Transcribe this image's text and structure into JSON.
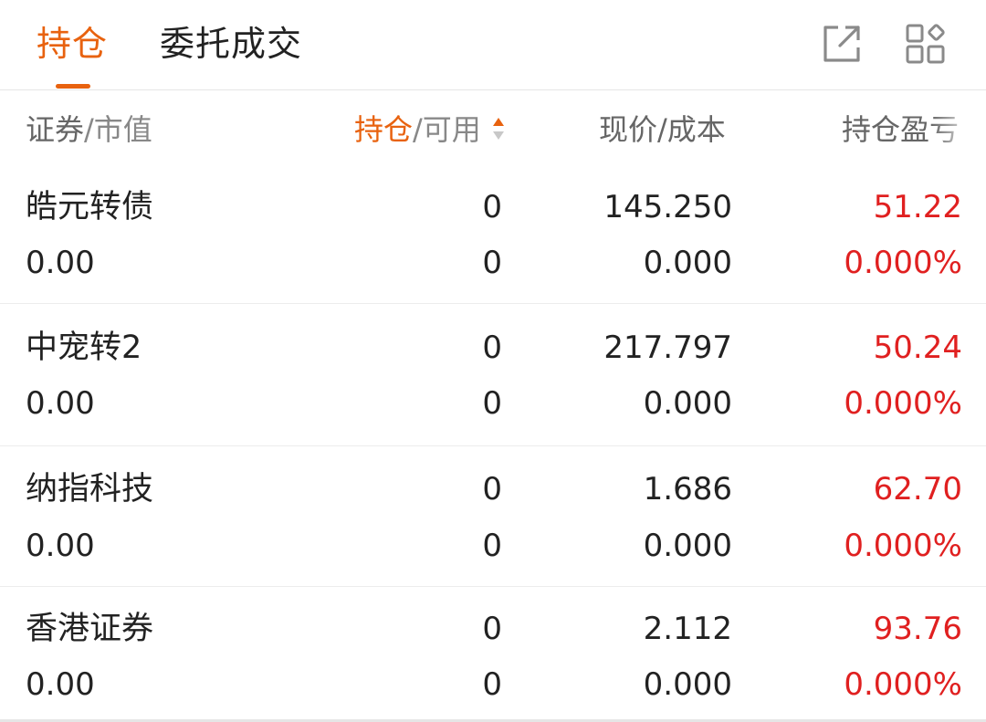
{
  "tabs": [
    {
      "label": "持仓",
      "active": true
    },
    {
      "label": "委托成交",
      "active": false
    }
  ],
  "icons": {
    "share": "share-external-icon",
    "layout": "grid-layout-icon",
    "sort": "sort-arrows-icon"
  },
  "colors": {
    "accent": "#e8620f",
    "profit": "#e02020"
  },
  "columns": {
    "security": {
      "primary": "证券",
      "secondary": "/市值"
    },
    "holding": {
      "primary": "持仓",
      "secondary": "/可用"
    },
    "price": {
      "primary": "现价/成本"
    },
    "pl": {
      "primary": "持仓盈亏"
    }
  },
  "positions": [
    {
      "name": "皓元转债",
      "market_value": "0.00",
      "holding": "0",
      "available": "0",
      "price": "145.250",
      "cost": "0.000",
      "pl": "51.22",
      "pl_pct": "0.000%"
    },
    {
      "name": "中宠转2",
      "market_value": "0.00",
      "holding": "0",
      "available": "0",
      "price": "217.797",
      "cost": "0.000",
      "pl": "50.24",
      "pl_pct": "0.000%"
    },
    {
      "name": "纳指科技",
      "market_value": "0.00",
      "holding": "0",
      "available": "0",
      "price": "1.686",
      "cost": "0.000",
      "pl": "62.70",
      "pl_pct": "0.000%"
    },
    {
      "name": "香港证券",
      "market_value": "0.00",
      "holding": "0",
      "available": "0",
      "price": "2.112",
      "cost": "0.000",
      "pl": "93.76",
      "pl_pct": "0.000%"
    }
  ]
}
